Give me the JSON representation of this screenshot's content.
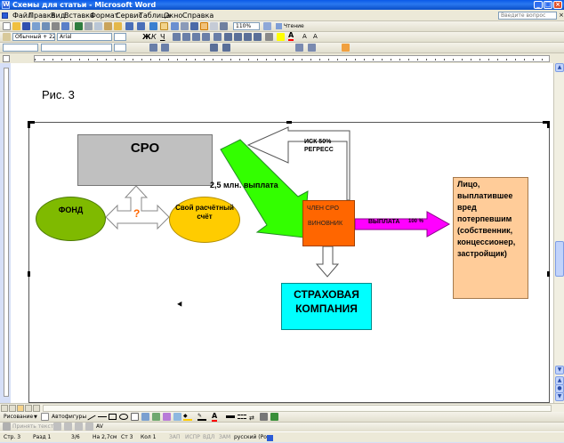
{
  "window": {
    "title": "Схемы для статьи - Microsoft Word",
    "help_placeholder": "Введите вопрос",
    "icon_letter": "W"
  },
  "menu": [
    "Файл",
    "Правка",
    "Вид",
    "Вставка",
    "Формат",
    "Сервис",
    "Таблица",
    "Окно",
    "Справка"
  ],
  "toolbar": {
    "zoom": "110%",
    "read_label": "Чтение",
    "style": "Обычный + 22 п",
    "font": "Arial"
  },
  "document": {
    "figure_label": "Рис. 3",
    "diagram": {
      "sro": "СРО",
      "fond": "ФОНД",
      "schet": "Свой расчётный счёт",
      "question": "?",
      "member_line1": "ЧЛЕН СРО",
      "member_line2": "ВИНОВНИК",
      "insurance": "СТРАХОВАЯ КОМПАНИЯ",
      "person": "Лицо, выплатившее вред потерпевшим (собственник, концессионер, застройщик)",
      "payment_label": "2,5 млн. выплата",
      "regress_label": "ИСК 50% РЕГРЕСС",
      "payout_label": "ВЫПЛАТА",
      "payout_percent": "100 %"
    },
    "colors": {
      "sro": "#c0c0c0",
      "fond": "#7fba00",
      "schet": "#ffcc00",
      "member": "#ff6600",
      "insurance": "#00ffff",
      "person": "#ffcc99",
      "green_arrow": "#33ff00",
      "payout_arrow": "#ff00ff"
    }
  },
  "drawing_toolbar": {
    "draw": "Рисование",
    "autoshapes": "Автофигуры"
  },
  "toolbar5": {
    "apply_text": "Принять текст"
  },
  "status": {
    "page": "Стр. 3",
    "section": "Разд 1",
    "pages": "3/6",
    "at": "На 2,7см",
    "line": "Ст 3",
    "col": "Кол 1",
    "rec": "ЗАП",
    "trk": "ИСПР",
    "ext": "ВДЛ",
    "ovr": "ЗАМ",
    "lang": "русский (Ро"
  }
}
